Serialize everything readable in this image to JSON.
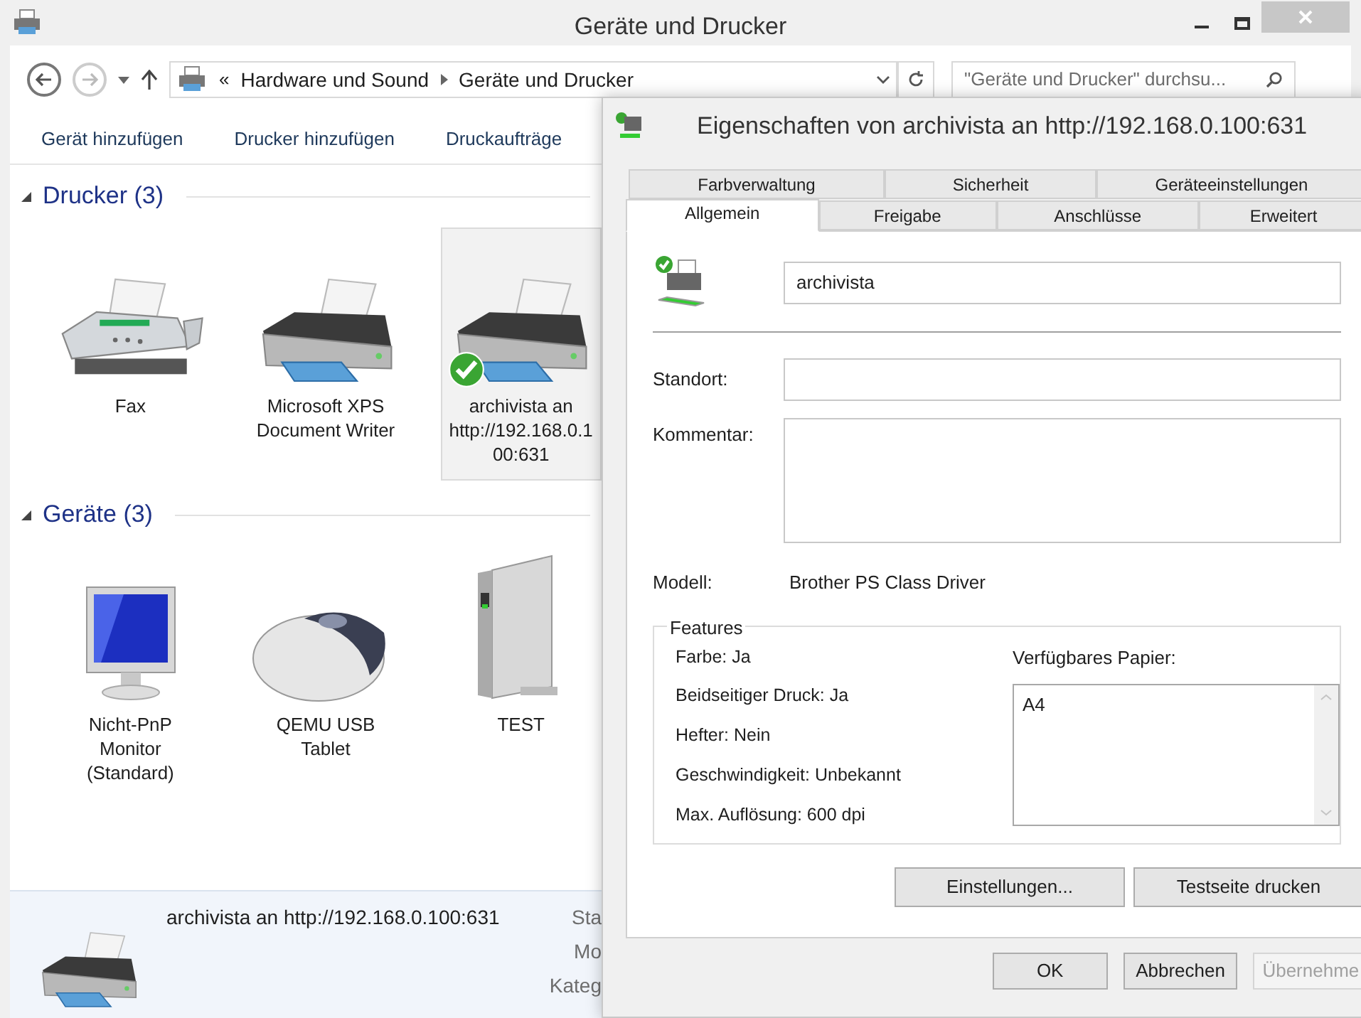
{
  "window": {
    "title": "Geräte und Drucker"
  },
  "address_bar": {
    "overflow_marker": "«",
    "breadcrumbs": [
      "Hardware und Sound",
      "Geräte und Drucker"
    ]
  },
  "search": {
    "placeholder": "\"Geräte und Drucker\" durchsu..."
  },
  "commands": [
    "Gerät hinzufügen",
    "Drucker hinzufügen",
    "Druckaufträge"
  ],
  "groups": [
    {
      "title": "Drucker (3)",
      "expanded": true,
      "items": [
        {
          "kind": "fax",
          "label": "Fax",
          "selected": false,
          "default": false
        },
        {
          "kind": "printer",
          "label": "Microsoft XPS Document Writer",
          "selected": false,
          "default": false
        },
        {
          "kind": "printer",
          "label": "archivista an http://192.168.0.100:631",
          "selected": true,
          "default": true
        }
      ]
    },
    {
      "title": "Geräte (3)",
      "expanded": true,
      "items": [
        {
          "kind": "monitor",
          "label": "Nicht-PnP Monitor (Standard)",
          "selected": false,
          "default": false
        },
        {
          "kind": "mouse",
          "label": "QEMU USB Tablet",
          "selected": false,
          "default": false
        },
        {
          "kind": "drive",
          "label": "TEST",
          "selected": false,
          "default": false
        }
      ]
    }
  ],
  "details_pane": {
    "name": "archivista an http://192.168.0.100:631",
    "field_labels": [
      "Sta",
      "Mo",
      "Kateg"
    ]
  },
  "dialog": {
    "title": "Eigenschaften von archivista an http://192.168.0.100:631",
    "tab_rows": [
      [
        {
          "label": "Farbverwaltung",
          "selected": false
        },
        {
          "label": "Sicherheit",
          "selected": false
        },
        {
          "label": "Geräteeinstellungen",
          "selected": false
        }
      ],
      [
        {
          "label": "Allgemein",
          "selected": true
        },
        {
          "label": "Freigabe",
          "selected": false
        },
        {
          "label": "Anschlüsse",
          "selected": false
        },
        {
          "label": "Erweitert",
          "selected": false
        }
      ]
    ],
    "printer_name": "archivista",
    "location_label": "Standort:",
    "comment_label": "Kommentar:",
    "model_label": "Modell:",
    "model": "Brother PS Class Driver",
    "features": {
      "title": "Features",
      "items": [
        "Farbe: Ja",
        "Beidseitiger Druck: Ja",
        "Hefter: Nein",
        "Geschwindigkeit: Unbekannt",
        "Max. Auflösung: 600 dpi"
      ],
      "paper_label": "Verfügbares Papier:",
      "paper": [
        "A4"
      ]
    },
    "actions": [
      "Einstellungen...",
      "Testseite drucken"
    ],
    "buttons": [
      {
        "label": "OK",
        "disabled": false
      },
      {
        "label": "Abbrechen",
        "disabled": false
      },
      {
        "label": "Übernehme",
        "disabled": true
      }
    ]
  }
}
